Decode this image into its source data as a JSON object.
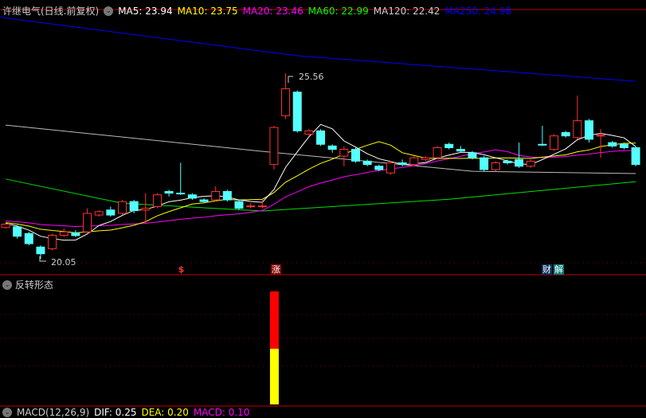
{
  "header": {
    "title": "许继电气(日线.前复权)",
    "ma": [
      {
        "label": "MA5: 23.94",
        "color": "#ffffff"
      },
      {
        "label": "MA10: 23.75",
        "color": "#ffff00"
      },
      {
        "label": "MA20: 23.46",
        "color": "#ff00ff"
      },
      {
        "label": "MA60: 22.99",
        "color": "#00ff00"
      },
      {
        "label": "MA120: 22.42",
        "color": "#cccccc"
      },
      {
        "label": "MA250: 24.98",
        "color": "#0000ff"
      }
    ]
  },
  "annotations": {
    "high": "25.56",
    "low": "20.05"
  },
  "markers": {
    "dollar": "$",
    "zhang": "涨",
    "cai": "财",
    "jie": "解"
  },
  "sub_panel": {
    "title": "反转形态",
    "signal_index": 23
  },
  "macd": {
    "label": "MACD(12,26,9)",
    "dif": "DIF: 0.25",
    "dea": "DEA: 0.20",
    "macd": "MACD: 0.10"
  },
  "colors": {
    "up": "#ff3232",
    "down": "#54ffff",
    "axis": "#c00000"
  },
  "chart_data": {
    "type": "candlestick",
    "title": "许继电气(日线.前复权)",
    "ohlc_fields": [
      "open",
      "close",
      "high",
      "low"
    ],
    "candles": [
      [
        20.98,
        21.08,
        21.12,
        20.95
      ],
      [
        21.0,
        20.72,
        21.05,
        20.65
      ],
      [
        20.8,
        20.5,
        20.85,
        20.45
      ],
      [
        20.4,
        20.2,
        20.45,
        20.05
      ],
      [
        20.35,
        20.75,
        20.8,
        20.3
      ],
      [
        20.75,
        20.85,
        20.95,
        20.7
      ],
      [
        20.82,
        20.74,
        20.9,
        20.7
      ],
      [
        20.85,
        21.4,
        21.55,
        20.8
      ],
      [
        21.35,
        21.45,
        21.5,
        21.3
      ],
      [
        21.5,
        21.35,
        21.6,
        21.3
      ],
      [
        21.4,
        21.75,
        21.8,
        21.35
      ],
      [
        21.75,
        21.48,
        21.8,
        21.4
      ],
      [
        21.5,
        21.55,
        22.0,
        21.1
      ],
      [
        21.6,
        21.95,
        22.0,
        21.55
      ],
      [
        22.05,
        22.0,
        22.1,
        21.9
      ],
      [
        22.0,
        21.98,
        22.9,
        21.95
      ],
      [
        21.95,
        21.85,
        22.0,
        21.8
      ],
      [
        21.8,
        21.75,
        21.85,
        21.7
      ],
      [
        21.8,
        22.05,
        22.2,
        21.75
      ],
      [
        22.05,
        21.8,
        22.1,
        21.75
      ],
      [
        21.75,
        21.55,
        21.8,
        21.5
      ],
      [
        21.6,
        21.62,
        21.7,
        21.55
      ],
      [
        21.6,
        21.62,
        21.8,
        21.55
      ],
      [
        22.85,
        23.95,
        24.0,
        22.7
      ],
      [
        24.3,
        25.1,
        25.56,
        24.2
      ],
      [
        25.0,
        23.85,
        25.05,
        23.8
      ],
      [
        23.75,
        23.85,
        23.9,
        23.7
      ],
      [
        23.85,
        23.45,
        23.9,
        23.4
      ],
      [
        23.4,
        23.3,
        23.45,
        23.2
      ],
      [
        23.1,
        23.3,
        23.4,
        22.8
      ],
      [
        23.3,
        22.95,
        23.35,
        22.9
      ],
      [
        22.95,
        22.85,
        23.0,
        22.8
      ],
      [
        22.8,
        22.7,
        22.85,
        22.65
      ],
      [
        22.6,
        22.9,
        22.95,
        22.55
      ],
      [
        22.9,
        22.85,
        23.0,
        22.8
      ],
      [
        22.85,
        23.05,
        23.1,
        22.8
      ],
      [
        23.0,
        23.05,
        23.1,
        22.95
      ],
      [
        23.05,
        23.35,
        23.4,
        23.0
      ],
      [
        23.45,
        23.35,
        23.5,
        23.3
      ],
      [
        23.3,
        23.25,
        23.4,
        23.2
      ],
      [
        23.2,
        23.05,
        23.25,
        23.0
      ],
      [
        23.05,
        22.7,
        23.1,
        22.65
      ],
      [
        22.7,
        22.9,
        22.95,
        22.65
      ],
      [
        22.95,
        22.9,
        23.0,
        22.85
      ],
      [
        23.0,
        22.8,
        23.5,
        22.75
      ],
      [
        22.8,
        22.95,
        23.0,
        22.75
      ],
      [
        23.45,
        23.43,
        24.0,
        23.4
      ],
      [
        23.3,
        23.7,
        23.75,
        23.25
      ],
      [
        23.8,
        23.7,
        23.85,
        23.65
      ],
      [
        23.65,
        24.15,
        24.9,
        23.6
      ],
      [
        24.15,
        23.6,
        24.2,
        23.5
      ],
      [
        23.7,
        23.72,
        23.9,
        23.05
      ],
      [
        23.5,
        23.4,
        23.55,
        23.35
      ],
      [
        23.45,
        23.35,
        23.5,
        23.3
      ],
      [
        23.35,
        22.85,
        23.4,
        22.8
      ]
    ],
    "ma_long": {
      "MA60": [
        [
          0,
          22.42
        ],
        [
          10,
          21.7
        ],
        [
          22,
          21.47
        ],
        [
          38,
          21.82
        ],
        [
          54,
          22.34
        ]
      ],
      "MA120": [
        [
          0,
          24.02
        ],
        [
          22,
          23.24
        ],
        [
          40,
          22.65
        ],
        [
          54,
          22.58
        ]
      ],
      "MA250": [
        [
          0,
          27.2
        ],
        [
          25,
          26.08
        ],
        [
          54,
          25.32
        ]
      ]
    },
    "price_range": [
      20.05,
      25.56
    ]
  }
}
